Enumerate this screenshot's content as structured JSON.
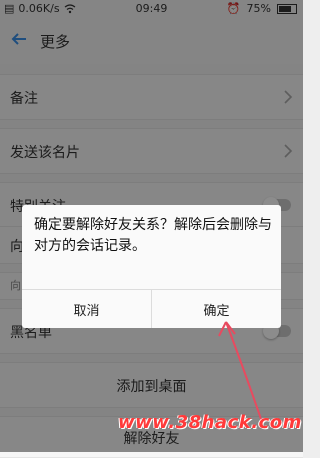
{
  "status_bar": {
    "network_speed": "0.06K/s",
    "time": "09:49",
    "battery": "75%",
    "battery_level": 0.75
  },
  "header": {
    "title": "更多"
  },
  "rows": {
    "note": "备注",
    "send_card": "发送该名片",
    "special_follow": "特别关注",
    "row4_partial": "向",
    "row5_partial": "向",
    "blacklist": "黑名单",
    "add_to_desktop": "添加到桌面",
    "remove_friend": "解除好友"
  },
  "dialog": {
    "message": "确定要解除好友关系？解除后会删除与对方的会话记录。",
    "cancel_label": "取消",
    "confirm_label": "确定"
  },
  "watermark": "www.38hack.com",
  "colors": {
    "annotation": "#e84a5f",
    "watermark": "#ff3a3a"
  }
}
